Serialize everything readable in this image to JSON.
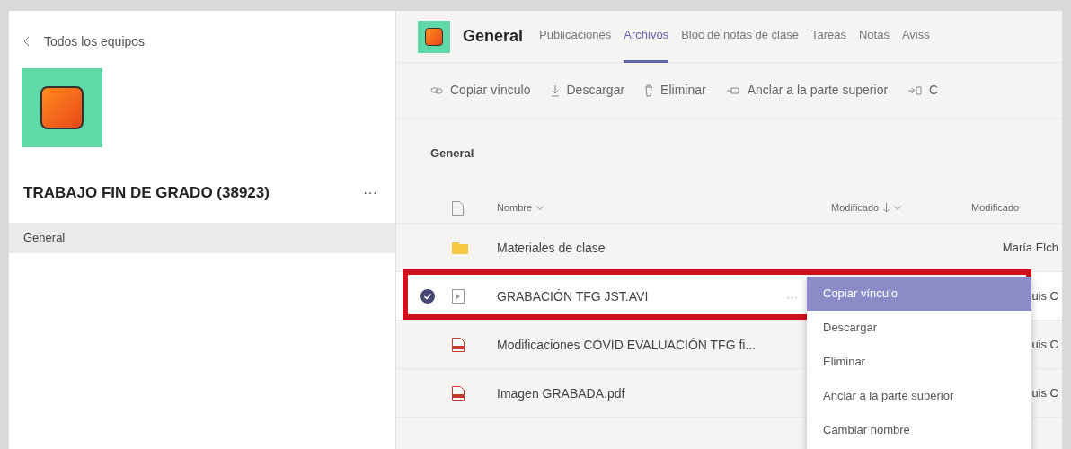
{
  "sidebar": {
    "back_link": "Todos los equipos",
    "team_name": "TRABAJO FIN DE GRADO (38923)",
    "more": "···",
    "channels": [
      {
        "label": "General",
        "selected": true
      }
    ]
  },
  "header": {
    "channel": "General",
    "tabs": [
      {
        "label": "Publicaciones",
        "selected": false
      },
      {
        "label": "Archivos",
        "selected": true
      },
      {
        "label": "Bloc de notas de clase",
        "selected": false
      },
      {
        "label": "Tareas",
        "selected": false
      },
      {
        "label": "Notas",
        "selected": false
      },
      {
        "label": "Aviss",
        "selected": false
      }
    ]
  },
  "toolbar": [
    {
      "kind": "link",
      "label": "Copiar vínculo"
    },
    {
      "kind": "download",
      "label": "Descargar"
    },
    {
      "kind": "delete",
      "label": "Eliminar"
    },
    {
      "kind": "pin",
      "label": "Anclar a la parte superior"
    },
    {
      "kind": "move",
      "label": "C"
    }
  ],
  "breadcrumb": "General",
  "table": {
    "columns": [
      "Nombre",
      "Modificado",
      "Modificado"
    ],
    "rows": [
      {
        "kind": "folder",
        "name": "Materiales de clase",
        "modified_by": "María Elch",
        "selected": false
      },
      {
        "kind": "video",
        "name": "GRABACIÓN TFG JST.AVI",
        "modified_by": "uis C",
        "selected": true,
        "more": "···"
      },
      {
        "kind": "pdf",
        "name": "Modificaciones COVID EVALUACIÓN TFG fi...",
        "modified_by": "uis C",
        "selected": false
      },
      {
        "kind": "pdf",
        "name": "Imagen GRABADA.pdf",
        "modified_by": "uis C",
        "selected": false
      }
    ]
  },
  "context_menu": [
    {
      "label": "Copiar vínculo",
      "selected": true
    },
    {
      "label": "Descargar",
      "selected": false
    },
    {
      "label": "Eliminar",
      "selected": false
    },
    {
      "label": "Anclar a la parte superior",
      "selected": false
    },
    {
      "label": "Cambiar nombre",
      "selected": false
    }
  ]
}
